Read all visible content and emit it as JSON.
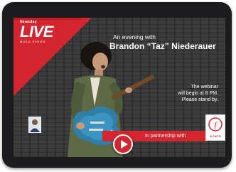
{
  "logo": {
    "small_text": "Newsday",
    "main_text": "LIVE",
    "sub_text": "MUSIC SERIES"
  },
  "event": {
    "intro": "An evening with",
    "artist": "Brandon “Taz” Niederauer"
  },
  "notice": {
    "line1": "The webinar",
    "line2": "will begin at 8 PM.",
    "line3": "Please stand by."
  },
  "partner": {
    "label": "In partnership with",
    "logo_text": "& FAITH"
  },
  "colors": {
    "brand_red": "#d42630",
    "device_frame": "#1c1c1e",
    "guitar_blue": "#2f7fa8"
  }
}
